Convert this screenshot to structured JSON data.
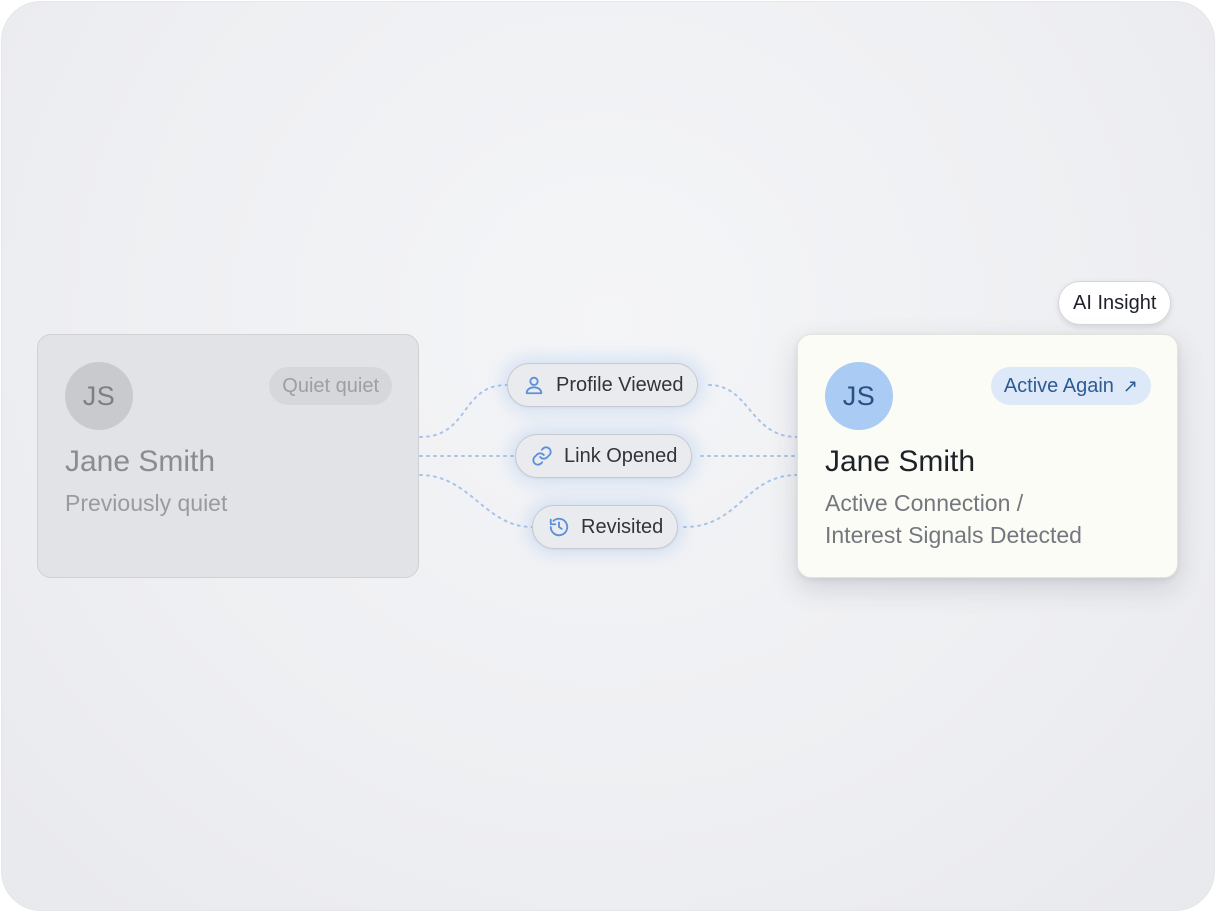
{
  "left_card": {
    "initials": "JS",
    "name": "Jane Smith",
    "status": "Previously quiet",
    "badge": "Quiet quiet"
  },
  "signals": [
    {
      "label": "Profile Viewed",
      "icon": "user-icon"
    },
    {
      "label": "Link Opened",
      "icon": "link-icon"
    },
    {
      "label": "Revisited",
      "icon": "history-icon"
    }
  ],
  "right_card": {
    "initials": "JS",
    "name": "Jane Smith",
    "status_line1": "Active Connection /",
    "status_line2": "Interest Signals Detected",
    "badge": "Active Again",
    "badge_arrow": "↗"
  },
  "ai_tag": "AI Insight",
  "colors": {
    "accent_blue": "#2d5b94",
    "icon_blue": "#5b8fd8",
    "connector": "#a9c4e8"
  }
}
